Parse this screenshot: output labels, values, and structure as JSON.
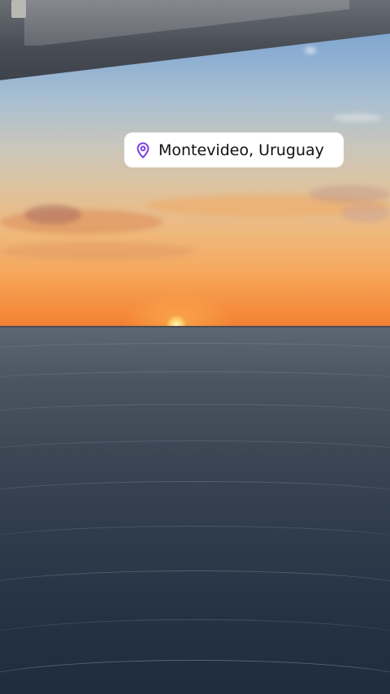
{
  "location_sticker": {
    "label": "Montevideo, Uruguay",
    "icon": "location-pin-icon",
    "icon_color": "#7b3fe4"
  },
  "colors": {
    "sky_top": "#6f98c9",
    "sunset_orange": "#f58a3a",
    "ocean": "#2d3a4a"
  }
}
